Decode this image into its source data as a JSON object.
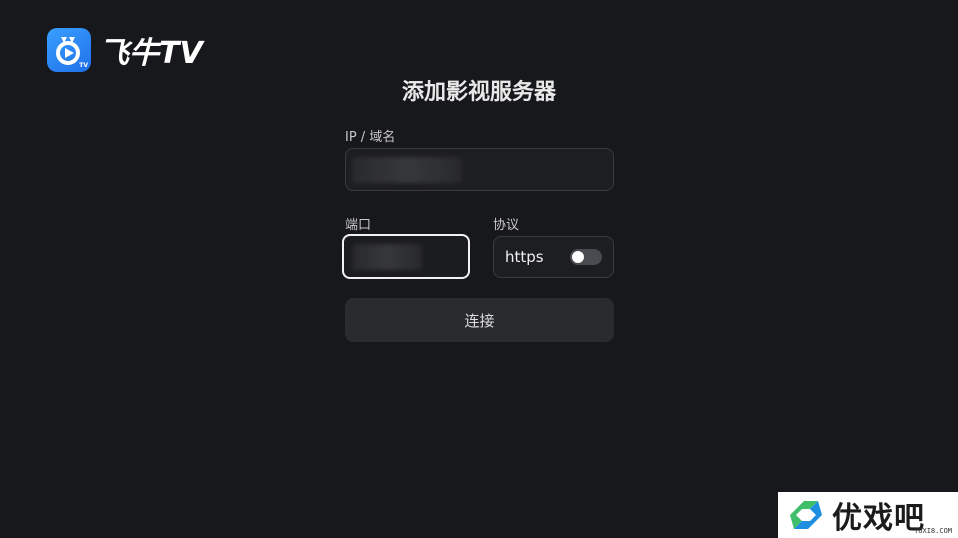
{
  "app": {
    "name": "飞牛TV",
    "logo_badge": "TV",
    "logo_icon": "feiniu-tv-logo-icon",
    "brand_color": "#2b8cf7"
  },
  "page": {
    "title": "添加影视服务器"
  },
  "form": {
    "host_label": "IP / 域名",
    "port_label": "端口",
    "protocol_label": "协议",
    "protocol_value": "https",
    "protocol_toggle_on": false,
    "connect_label": "连接"
  },
  "watermark": {
    "text": "优戏吧",
    "sub": "YOXI8.COM"
  }
}
